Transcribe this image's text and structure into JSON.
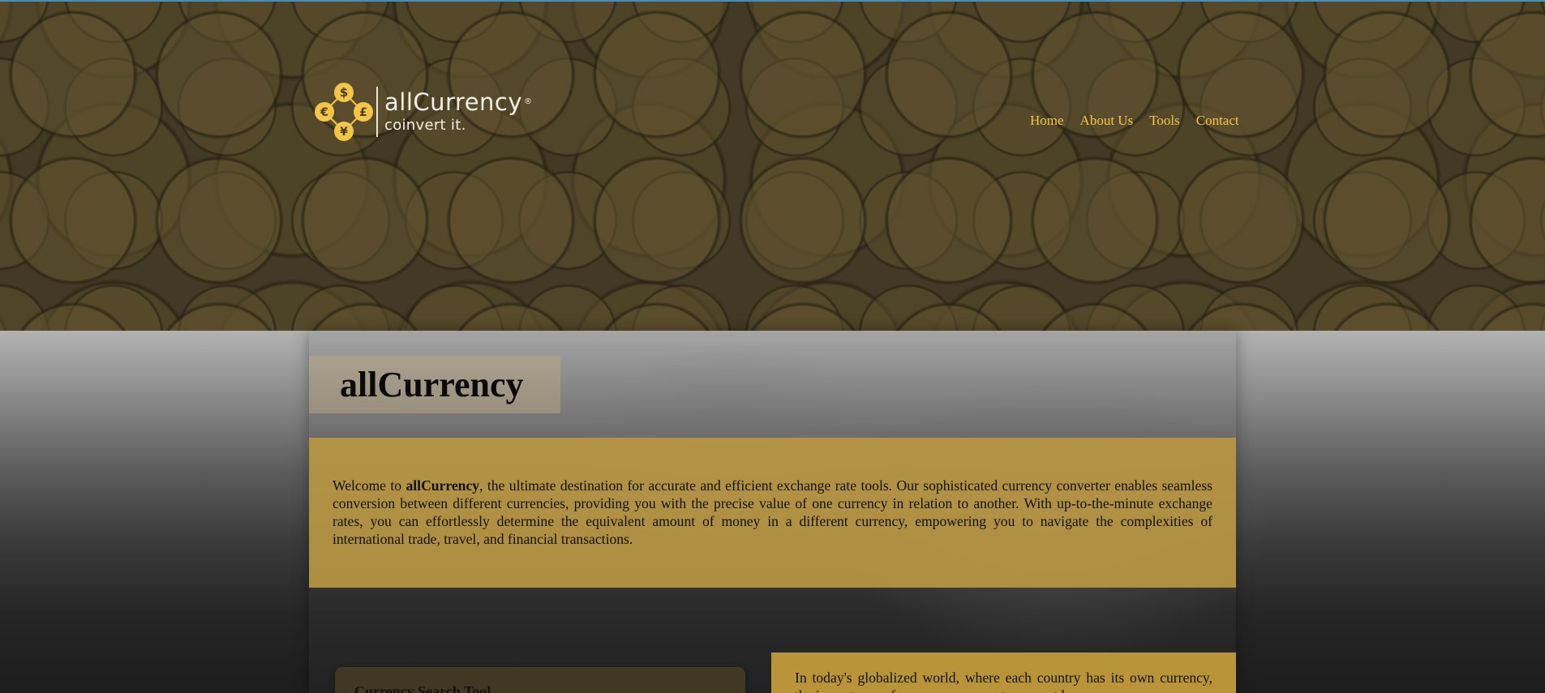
{
  "brand": {
    "name": "allCurrency",
    "registered_mark": "®",
    "tagline": "coinvert it.",
    "logo_symbols": [
      "$",
      "€",
      "£",
      "¥"
    ],
    "accent_color": "#f3c64a"
  },
  "nav": {
    "items": [
      {
        "label": "Home"
      },
      {
        "label": "About Us"
      },
      {
        "label": "Tools"
      },
      {
        "label": "Contact"
      }
    ]
  },
  "main": {
    "title": "allCurrency",
    "intro": {
      "prefix": "Welcome to ",
      "brand": "allCurrency",
      "body": ", the ultimate destination for accurate and efficient exchange rate tools. Our sophisticated currency converter enables seamless conversion between different currencies, providing you with the precise value of one currency in relation to another. With up-to-the-minute exchange rates, you can effortlessly determine the equivalent amount of money in a different currency, empowering you to navigate the complexities of international trade, travel, and financial transactions."
    },
    "tool_card": {
      "title": "Currency Search Tool"
    },
    "side_text": "In today's globalized world, where each country has its own currency, the importance of a currency converter cannot be"
  },
  "colors": {
    "top_line": "#4a8db5",
    "intro_bg": "#b89642",
    "side_bg": "#be983a"
  }
}
